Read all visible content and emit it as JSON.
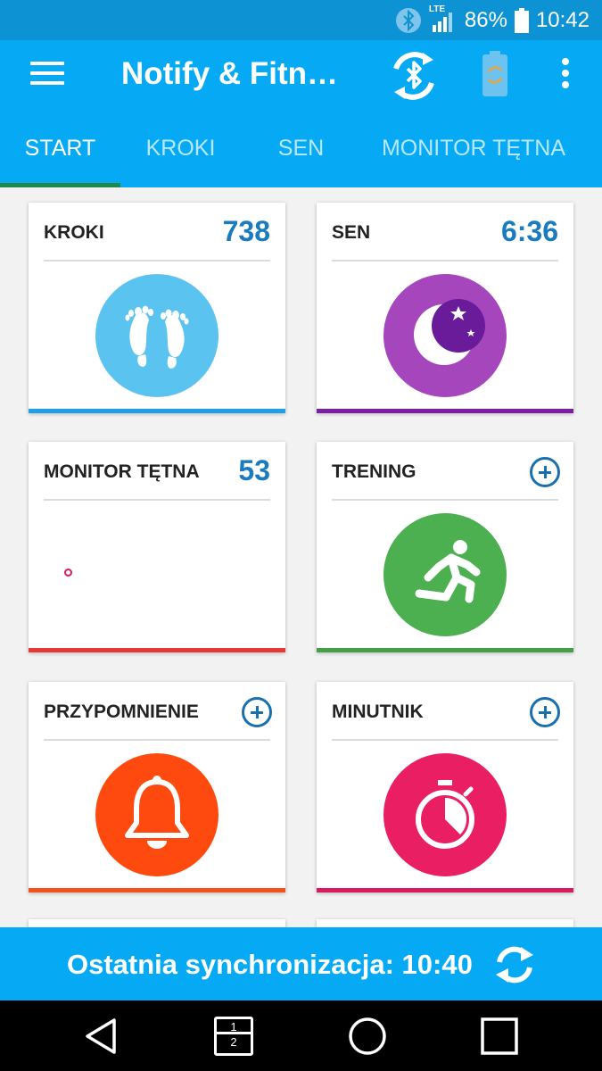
{
  "status_bar": {
    "bluetooth_icon": "bluetooth-icon",
    "network_label": "LTE",
    "battery_percent": "86%",
    "time": "10:42"
  },
  "app_bar": {
    "title": "Notify & Fitne…",
    "menu_icon": "hamburger-menu-icon",
    "bluetooth_sync_icon": "bluetooth-sync-icon",
    "battery_icon": "band-battery-icon",
    "overflow_icon": "more-vertical-icon"
  },
  "tabs": [
    {
      "label": "START",
      "active": true
    },
    {
      "label": "KROKI",
      "active": false
    },
    {
      "label": "SEN",
      "active": false
    },
    {
      "label": "MONITOR TĘTNA",
      "active": false
    }
  ],
  "cards": {
    "steps": {
      "title": "KROKI",
      "value": "738",
      "icon": "footprints-icon",
      "color": "#5bc3f0",
      "bar_color": "#1ea0e6"
    },
    "sleep": {
      "title": "SEN",
      "value": "6:36",
      "icon": "moon-stars-icon",
      "color": "#a646bd",
      "bar_color": "#7b1fa2"
    },
    "heart": {
      "title": "MONITOR TĘTNA",
      "value": "53",
      "bar_color": "#e53935"
    },
    "training": {
      "title": "TRENING",
      "icon": "running-person-icon",
      "color": "#4caf50",
      "bar_color": "#43a047"
    },
    "reminder": {
      "title": "PRZYPOMNIENIE",
      "icon": "bell-icon",
      "color": "#ff4a0f",
      "bar_color": "#f4511e"
    },
    "timer": {
      "title": "MINUTNIK",
      "icon": "stopwatch-icon",
      "color": "#e91e63",
      "bar_color": "#d81b60"
    }
  },
  "sync_bar": {
    "text": "Ostatnia synchronizacja: 10:40",
    "icon": "sync-icon"
  },
  "nav_bar": {
    "back_icon": "back-triangle-icon",
    "split_icon": "dual-window-icon",
    "split_top": "1",
    "split_bottom": "2",
    "home_icon": "home-circle-icon",
    "recents_icon": "recents-square-icon"
  }
}
